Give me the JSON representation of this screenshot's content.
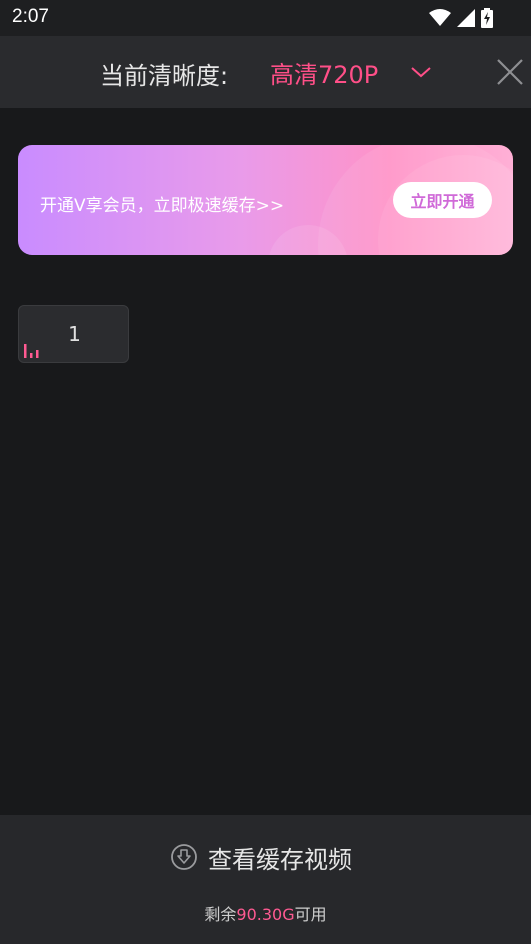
{
  "status_bar": {
    "time": "2:07",
    "icons": [
      "wifi-icon",
      "signal-icon",
      "battery-charging-icon"
    ]
  },
  "header": {
    "label": "当前清晰度:",
    "quality_value": "高清720P",
    "accent_color": "#ff4f88",
    "icons": [
      "chevron-down-icon",
      "close-icon"
    ]
  },
  "banner": {
    "text": "开通V享会员，立即极速缓存>>",
    "button_label": "立即开通"
  },
  "episodes": [
    {
      "label": "1",
      "playing": true
    }
  ],
  "bottom": {
    "view_cache_label": "查看缓存视频",
    "storage_prefix": "剩余",
    "storage_amount": "90.30G",
    "storage_suffix": "可用",
    "icon": "download-circle-icon"
  }
}
